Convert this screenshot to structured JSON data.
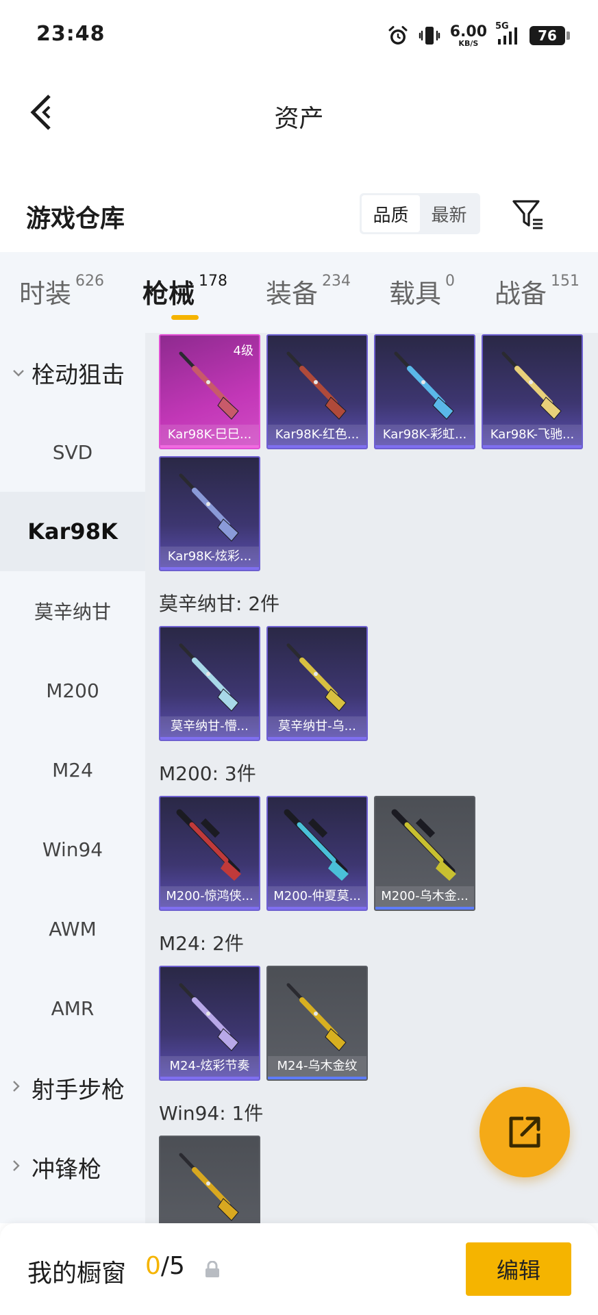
{
  "status_bar": {
    "time": "23:48",
    "net_speed_value": "6.00",
    "net_speed_unit": "KB/S",
    "signal_label": "5G",
    "battery": "76",
    "icons": [
      "alarm-icon",
      "vibrate-icon",
      "signal-icon",
      "battery-icon"
    ]
  },
  "nav": {
    "back_icon": "chevron-left-icon",
    "title": "资产"
  },
  "warehouse": {
    "title": "游戏仓库",
    "sort_options": [
      "品质",
      "最新"
    ],
    "sort_selected": "品质",
    "filter_icon": "filter-icon"
  },
  "tabs": [
    {
      "label": "时装",
      "count": "626"
    },
    {
      "label": "枪械",
      "count": "178"
    },
    {
      "label": "装备",
      "count": "234"
    },
    {
      "label": "载具",
      "count": "0"
    },
    {
      "label": "战备",
      "count": "151"
    }
  ],
  "active_tab": "枪械",
  "sidebar": {
    "groups": [
      {
        "label": "栓动狙击",
        "expanded": true,
        "icon": "chevron-down-icon"
      },
      {
        "label": "射手步枪",
        "expanded": false,
        "icon": "chevron-right-icon"
      },
      {
        "label": "冲锋枪",
        "expanded": false,
        "icon": "chevron-right-icon"
      }
    ],
    "items": [
      "SVD",
      "Kar98K",
      "莫辛纳甘",
      "M200",
      "M24",
      "Win94",
      "AWM",
      "AMR"
    ],
    "active_item": "Kar98K"
  },
  "content": {
    "kar98k_cards": [
      {
        "label": "Kar98K-巳巳...",
        "rarity": "pink",
        "level": "4级",
        "accent": "#c85a6a"
      },
      {
        "label": "Kar98K-红色...",
        "rarity": "purple",
        "accent": "#b04a3a"
      },
      {
        "label": "Kar98K-彩虹...",
        "rarity": "purple",
        "accent": "#5ab8e8"
      },
      {
        "label": "Kar98K-飞驰...",
        "rarity": "purple",
        "accent": "#e8d07a"
      },
      {
        "label": "Kar98K-炫彩...",
        "rarity": "purple",
        "accent": "#8a9ad8"
      }
    ],
    "sections": [
      {
        "title": "莫辛纳甘: 2件",
        "cards": [
          {
            "label": "莫辛纳甘-懵...",
            "rarity": "purple",
            "accent": "#a8d8e8"
          },
          {
            "label": "莫辛纳甘-乌...",
            "rarity": "purple",
            "accent": "#d8c040"
          }
        ]
      },
      {
        "title": "M200: 3件",
        "cards": [
          {
            "label": "M200-惊鸿侠...",
            "rarity": "purple",
            "accent": "#c03a3a"
          },
          {
            "label": "M200-仲夏莫...",
            "rarity": "purple",
            "accent": "#4ac0d8"
          },
          {
            "label": "M200-乌木金...",
            "rarity": "gray",
            "accent": "#c8c030"
          }
        ]
      },
      {
        "title": "M24: 2件",
        "cards": [
          {
            "label": "M24-炫彩节奏",
            "rarity": "purple",
            "accent": "#b8a8e8"
          },
          {
            "label": "M24-乌木金纹",
            "rarity": "gray",
            "accent": "#d8b020"
          }
        ]
      },
      {
        "title": "Win94: 1件",
        "cards": [
          {
            "label": "",
            "rarity": "gray",
            "accent": "#d8a820"
          }
        ]
      }
    ]
  },
  "fab": {
    "icon": "share-external-icon"
  },
  "bottom_bar": {
    "label": "我的橱窗",
    "count_current": "0",
    "count_separator": "/",
    "count_total": "5",
    "lock_icon": "lock-icon",
    "edit_label": "编辑"
  },
  "colors": {
    "accent_yellow": "#f5b400",
    "fab_orange": "#f5aa17",
    "purple_card": "#3d3670",
    "pink_card": "#c237b7",
    "gray_card": "#55585e"
  }
}
